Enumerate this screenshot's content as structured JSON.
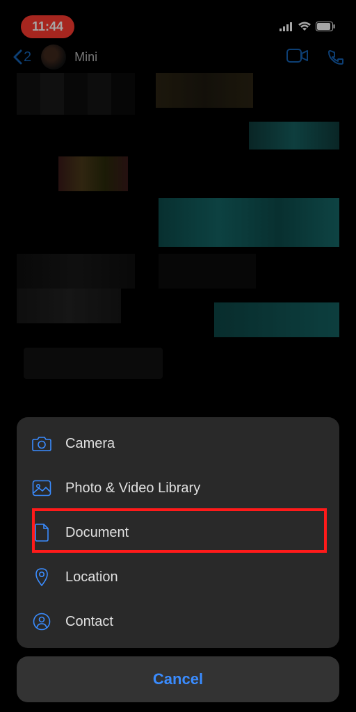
{
  "status_bar": {
    "time": "11:44"
  },
  "nav": {
    "back_badge": "2",
    "title": "Mini"
  },
  "action_sheet": {
    "items": [
      {
        "label": "Camera",
        "icon": "camera-icon"
      },
      {
        "label": "Photo & Video Library",
        "icon": "photo-library-icon"
      },
      {
        "label": "Document",
        "icon": "document-icon",
        "highlighted": true
      },
      {
        "label": "Location",
        "icon": "location-icon"
      },
      {
        "label": "Contact",
        "icon": "contact-icon"
      }
    ],
    "cancel_label": "Cancel"
  },
  "colors": {
    "accent": "#3a8cff",
    "time_pill": "#ff3b30",
    "highlight": "#ff1a1a"
  }
}
